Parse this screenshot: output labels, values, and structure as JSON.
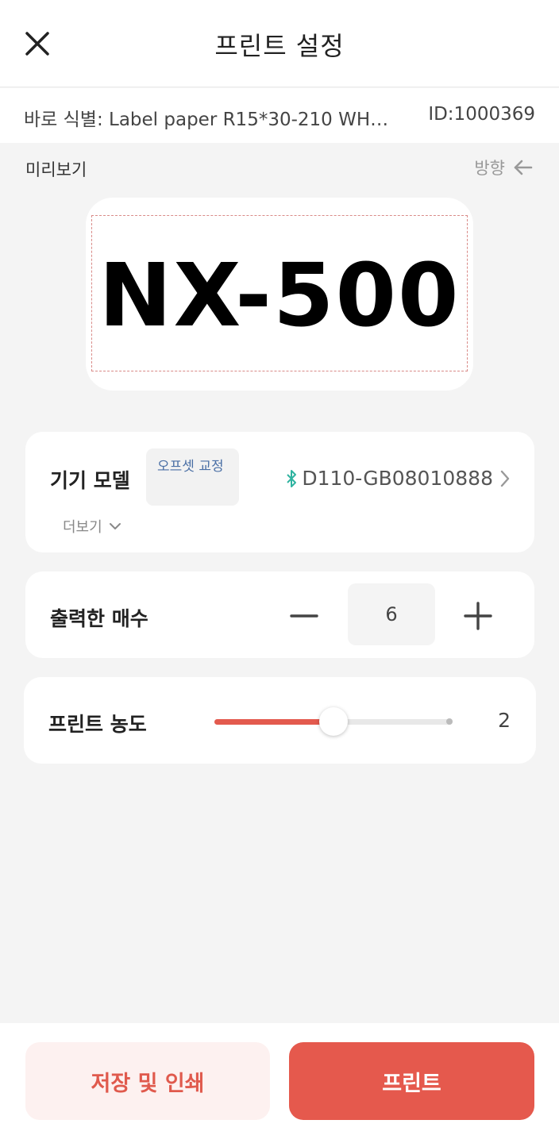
{
  "header": {
    "title": "프린트 설정"
  },
  "label_info": {
    "name": "바로 식별: Label paper R15*30-210 WH…",
    "id": "ID:1000369"
  },
  "preview": {
    "label": "미리보기",
    "direction_label": "방향",
    "content_text": "NX-500"
  },
  "device": {
    "title": "기기 모델",
    "calibration_label": "오프셋 교정",
    "device_name": "D110-GB08010888",
    "more_label": "더보기"
  },
  "copies": {
    "title": "출력한 매수",
    "value": "6"
  },
  "density": {
    "title": "프린트 농도",
    "value": "2",
    "level_fraction": 0.5
  },
  "actions": {
    "save_print_label": "저장 및 인쇄",
    "print_label": "프린트"
  },
  "colors": {
    "accent": "#e5594d",
    "accent_light": "#fdf1f0",
    "bluetooth": "#2fb3a0",
    "calibration_text": "#4a6fa5"
  },
  "icons": {
    "close": "close-icon",
    "direction": "arrow-left-icon",
    "bluetooth": "bluetooth-icon",
    "chevron_right": "chevron-right-icon",
    "chevron_down": "chevron-down-icon",
    "minus": "minus-icon",
    "plus": "plus-icon"
  }
}
